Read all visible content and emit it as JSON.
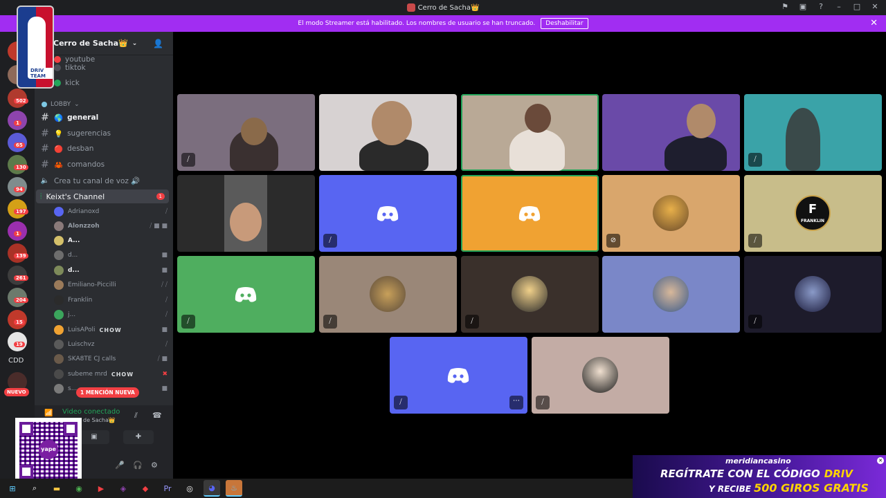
{
  "window": {
    "title": "Cerro de Sacha👑",
    "icons": [
      "flag-icon",
      "inbox-icon",
      "help-icon",
      "minimize-icon",
      "maximize-icon",
      "close-icon"
    ]
  },
  "streamer_banner": {
    "text": "El modo Streamer está habilitado. Los nombres de usuario se han truncado.",
    "button": "Deshabilitar",
    "color": "#a12df2"
  },
  "server_rail": {
    "badges": [
      "502",
      "1",
      "65",
      "130",
      "94",
      "197",
      "1",
      "139",
      "261",
      "204",
      "15",
      "19"
    ],
    "cdd_label": "CDD",
    "new_label": "NUEVO"
  },
  "logo": {
    "text": "DRIV TEAM"
  },
  "sidebar": {
    "server_name": "Cerro de Sacha👑",
    "top_channels": [
      {
        "label": "youtube",
        "color": "#f23f43"
      },
      {
        "label": "tiktok",
        "color": "#4e5058"
      },
      {
        "label": "kick",
        "color": "#23a55a"
      }
    ],
    "category": "LOBBY",
    "text_channels": [
      {
        "label": "general",
        "emoji": "🌎",
        "active": true
      },
      {
        "label": "sugerencias",
        "emoji": "💡",
        "active": false
      },
      {
        "label": "desban",
        "emoji": "🔴",
        "active": false
      },
      {
        "label": "comandos",
        "emoji": "🦀",
        "active": false
      }
    ],
    "create_voice": "Crea tu canal de voz 🔊",
    "voice_channel": {
      "label": "Keixt's Channel",
      "count": "1"
    },
    "members": [
      {
        "name": "Adrianoxd",
        "icons": "⧸"
      },
      {
        "name": "Alonzzoh",
        "icons": "⧸ ■ ■"
      },
      {
        "name": "A...",
        "icons": ""
      },
      {
        "name": "d...",
        "icons": "■"
      },
      {
        "name": "d...",
        "icons": "■"
      },
      {
        "name": "Emiliano-Piccilli",
        "icons": "⧸ ⧸"
      },
      {
        "name": "Franklin",
        "icons": "⧸"
      },
      {
        "name": "j...",
        "icons": "⧸"
      },
      {
        "name": "LuisAPoli",
        "tag": "CHOW",
        "icons": "■"
      },
      {
        "name": "Luischvz",
        "icons": "⧸"
      },
      {
        "name": "SKA8TE CJ calls",
        "icons": "⧸ ■"
      },
      {
        "name": "subeme mrd",
        "tag": "CHOW",
        "icons": "✖"
      },
      {
        "name": "s...",
        "icons": "■"
      }
    ],
    "mention_pill": "1 MENCIÓN NUEVA"
  },
  "voice_panel": {
    "status": "Video conectado",
    "server": "de Sacha👑",
    "accent": "#23a55a"
  },
  "stage": {
    "tiles": [
      {
        "kind": "camera",
        "bg": "#7b6e7e",
        "speaking": false,
        "muted": true
      },
      {
        "kind": "camera",
        "bg": "#d7d2d2",
        "speaking": false,
        "muted": false
      },
      {
        "kind": "camera",
        "bg": "#b9a996",
        "speaking": true,
        "muted": false
      },
      {
        "kind": "camera",
        "bg": "#6a4aa8",
        "speaking": false,
        "muted": false
      },
      {
        "kind": "camera",
        "bg": "#3aa3a8",
        "speaking": false,
        "muted": true
      },
      {
        "kind": "camera",
        "bg": "#2b2b2b",
        "speaking": false,
        "muted": false
      },
      {
        "kind": "discord",
        "bg": "#5865f2",
        "speaking": false,
        "muted": true
      },
      {
        "kind": "discord",
        "bg": "#f0a232",
        "speaking": true,
        "muted": false
      },
      {
        "kind": "avatar",
        "bg": "#d9a66c",
        "speaking": false,
        "muted": true
      },
      {
        "kind": "avatar",
        "bg": "#c8bd8a",
        "speaking": false,
        "muted": true,
        "avatar_text": "FRANKLIN"
      },
      {
        "kind": "discord",
        "bg": "#4fae5f",
        "speaking": false,
        "muted": true
      },
      {
        "kind": "avatar",
        "bg": "#9a8778",
        "speaking": false,
        "muted": true
      },
      {
        "kind": "avatar",
        "bg": "#3a302b",
        "speaking": false,
        "muted": true
      },
      {
        "kind": "avatar",
        "bg": "#7a87c8",
        "speaking": false,
        "muted": false
      },
      {
        "kind": "avatar",
        "bg": "#1d1b2b",
        "speaking": false,
        "muted": true
      },
      {
        "kind": "discord",
        "bg": "#5865f2",
        "speaking": false,
        "muted": true,
        "more": "⋯"
      },
      {
        "kind": "avatar",
        "bg": "#c3aca5",
        "speaking": false,
        "muted": true
      }
    ]
  },
  "promo": {
    "brand": "meridiancasino",
    "line1": "REGÍTRATE CON EL CÓDIGO",
    "code": "DRIV",
    "line2": "Y RECIBE",
    "offer": "500 GIROS GRATIS"
  },
  "taskbar": {
    "apps": [
      "windows-icon",
      "search-icon",
      "file-explorer-icon",
      "chrome-icon",
      "media-icon",
      "stream-icon",
      "app-icon",
      "premiere-icon",
      "obs-icon",
      "discord-icon",
      "steam-icon"
    ]
  }
}
